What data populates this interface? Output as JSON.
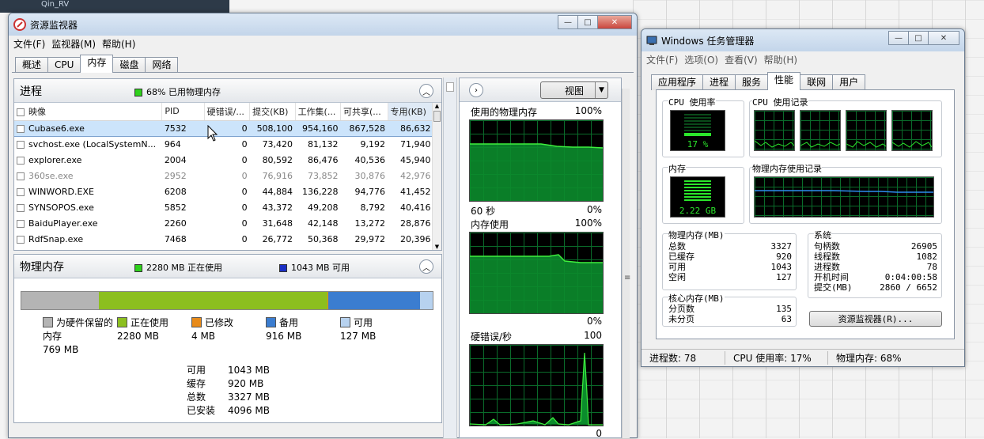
{
  "background": {
    "window_title": "Qin_RV"
  },
  "resmon": {
    "title": "资源监视器",
    "menu": [
      "文件(F)",
      "监视器(M)",
      "帮助(H)"
    ],
    "tabs": [
      "概述",
      "CPU",
      "内存",
      "磁盘",
      "网络"
    ],
    "active_tab": "内存",
    "processes": {
      "title": "进程",
      "status": "68% 已用物理内存",
      "columns": [
        "映像",
        "PID",
        "硬错误/...",
        "提交(KB)",
        "工作集(...",
        "可共享(...",
        "专用(KB)"
      ],
      "rows": [
        {
          "name": "Cubase6.exe",
          "pid": "7532",
          "hard": "0",
          "commit": "508,100",
          "ws": "954,160",
          "share": "867,528",
          "priv": "86,632"
        },
        {
          "name": "svchost.exe (LocalSystemN...",
          "pid": "964",
          "hard": "0",
          "commit": "73,420",
          "ws": "81,132",
          "share": "9,192",
          "priv": "71,940"
        },
        {
          "name": "explorer.exe",
          "pid": "2004",
          "hard": "0",
          "commit": "80,592",
          "ws": "86,476",
          "share": "40,536",
          "priv": "45,940"
        },
        {
          "name": "360se.exe",
          "pid": "2952",
          "hard": "0",
          "commit": "76,916",
          "ws": "73,852",
          "share": "30,876",
          "priv": "42,976"
        },
        {
          "name": "WINWORD.EXE",
          "pid": "6208",
          "hard": "0",
          "commit": "44,884",
          "ws": "136,228",
          "share": "94,776",
          "priv": "41,452"
        },
        {
          "name": "SYNSOPOS.exe",
          "pid": "5852",
          "hard": "0",
          "commit": "43,372",
          "ws": "49,208",
          "share": "8,792",
          "priv": "40,416"
        },
        {
          "name": "BaiduPlayer.exe",
          "pid": "2260",
          "hard": "0",
          "commit": "31,648",
          "ws": "42,148",
          "share": "13,272",
          "priv": "28,876"
        },
        {
          "name": "RdfSnap.exe",
          "pid": "7468",
          "hard": "0",
          "commit": "26,772",
          "ws": "50,368",
          "share": "29,972",
          "priv": "20,396"
        }
      ]
    },
    "physmem": {
      "title": "物理内存",
      "in_use": "2280 MB 正在使用",
      "available": "1043 MB 可用",
      "legend": [
        {
          "label": "为硬件保留的内存",
          "line1": "为硬件保留的",
          "line2": "内存",
          "value": "769 MB",
          "color": "#b4b4b4"
        },
        {
          "label": "正在使用",
          "value": "2280 MB",
          "color": "#8cbf1f"
        },
        {
          "label": "已修改",
          "value": "4 MB",
          "color": "#e88b1a"
        },
        {
          "label": "备用",
          "value": "916 MB",
          "color": "#3b7dd0"
        },
        {
          "label": "可用",
          "value": "127 MB",
          "color": "#b7d2ef"
        }
      ],
      "summary": [
        {
          "k": "可用",
          "v": "1043 MB"
        },
        {
          "k": "缓存",
          "v": "920 MB"
        },
        {
          "k": "总数",
          "v": "3327 MB"
        },
        {
          "k": "已安装",
          "v": "4096 MB"
        }
      ]
    },
    "graphs": {
      "view_label": "视图",
      "g1_title": "使用的物理内存",
      "g1_max": "100%",
      "g1_time": "60 秒",
      "g1_min": "0%",
      "g2_title": "内存使用",
      "g2_max": "100%",
      "g2_min": "0%",
      "g3_title": "硬错误/秒",
      "g3_max": "100",
      "g3_min": "0"
    }
  },
  "taskmgr": {
    "title": "Windows 任务管理器",
    "menu": [
      "文件(F)",
      "选项(O)",
      "查看(V)",
      "帮助(H)"
    ],
    "tabs": [
      "应用程序",
      "进程",
      "服务",
      "性能",
      "联网",
      "用户"
    ],
    "active_tab": "性能",
    "cpu_usage_label": "CPU 使用率",
    "cpu_usage_value": "17 %",
    "cpu_history_label": "CPU 使用记录",
    "mem_label": "内存",
    "mem_value": "2.22 GB",
    "mem_history_label": "物理内存使用记录",
    "phys": {
      "title": "物理内存(MB)",
      "rows": [
        {
          "k": "总数",
          "v": "3327"
        },
        {
          "k": "已缓存",
          "v": "920"
        },
        {
          "k": "可用",
          "v": "1043"
        },
        {
          "k": "空闲",
          "v": "127"
        }
      ]
    },
    "kernel": {
      "title": "核心内存(MB)",
      "rows": [
        {
          "k": "分页数",
          "v": "135"
        },
        {
          "k": "未分页",
          "v": "63"
        }
      ]
    },
    "system": {
      "title": "系统",
      "rows": [
        {
          "k": "句柄数",
          "v": "26905"
        },
        {
          "k": "线程数",
          "v": "1082"
        },
        {
          "k": "进程数",
          "v": "78"
        },
        {
          "k": "开机时间",
          "v": "0:04:00:58"
        },
        {
          "k": "提交(MB)",
          "v": "2860 / 6652"
        }
      ]
    },
    "resmon_button": "资源监视器(R)...",
    "status": {
      "processes": "进程数: 78",
      "cpu": "CPU 使用率: 17%",
      "mem": "物理内存: 68%"
    }
  }
}
